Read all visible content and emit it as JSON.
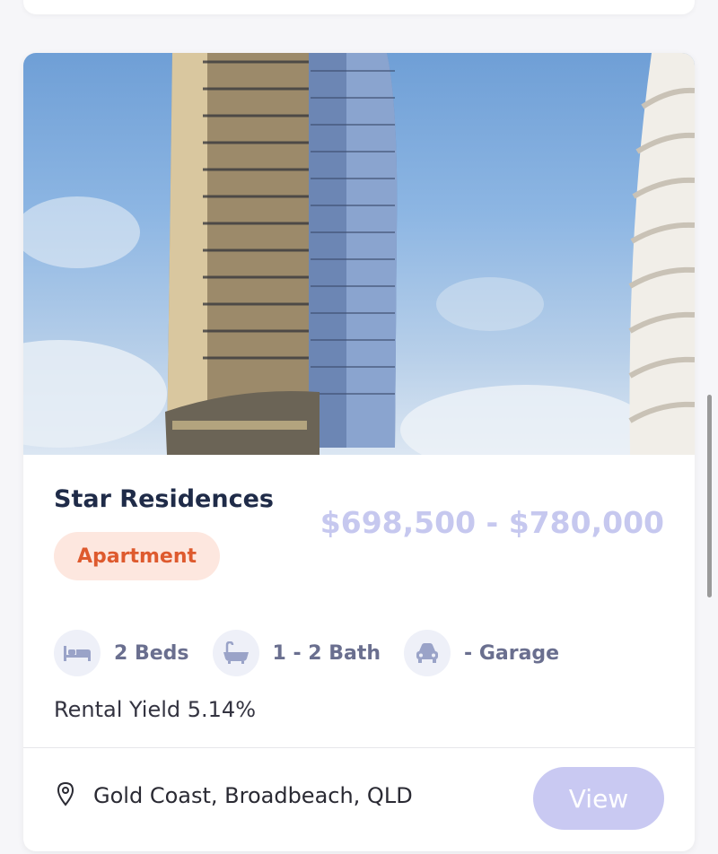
{
  "listing": {
    "title": "Star Residences",
    "price_range": "$698,500 - $780,000",
    "type_badge": "Apartment",
    "features": [
      {
        "icon": "bed-icon",
        "label": "2 Beds"
      },
      {
        "icon": "bath-icon",
        "label": "1 - 2 Bath"
      },
      {
        "icon": "car-icon",
        "label": "- Garage"
      }
    ],
    "rental_yield": "Rental Yield 5.14%",
    "location": "Gold Coast, Broadbeach, QLD",
    "view_label": "View"
  },
  "colors": {
    "title": "#1f2b48",
    "price": "#c6c8ef",
    "badge_bg": "#fde7df",
    "badge_text": "#de5a2e",
    "feature_text": "#6a6f8f",
    "view_button": "#c9c9f2"
  }
}
